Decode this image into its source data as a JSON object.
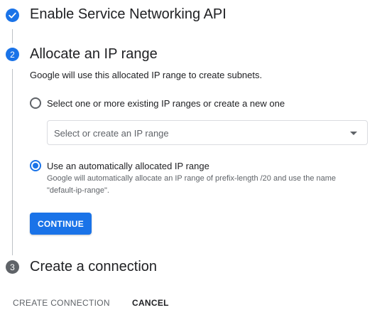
{
  "steps": [
    {
      "number": "",
      "title": "Enable Service Networking API",
      "state": "done"
    },
    {
      "number": "2",
      "title": "Allocate an IP range",
      "state": "active"
    },
    {
      "number": "3",
      "title": "Create a connection",
      "state": "pending"
    }
  ],
  "allocate": {
    "description": "Google will use this allocated IP range to create subnets.",
    "option_existing": {
      "label": "Select one or more existing IP ranges or create a new one",
      "selected": false
    },
    "ip_range_select": {
      "placeholder": "Select or create an IP range"
    },
    "option_auto": {
      "label": "Use an automatically allocated IP range",
      "selected": true,
      "help_line1": "Google will automatically allocate an IP range of prefix-length /20 and use the name",
      "help_line2": "\"default-ip-range\"."
    },
    "continue_label": "CONTINUE"
  },
  "footer": {
    "create_label": "CREATE CONNECTION",
    "cancel_label": "CANCEL"
  },
  "colors": {
    "accent": "#1a73e8",
    "pending_step": "#5f6368",
    "connector": "#bdc1c6"
  },
  "icons": {
    "step1": "check-icon",
    "select": "dropdown-arrow-icon"
  }
}
